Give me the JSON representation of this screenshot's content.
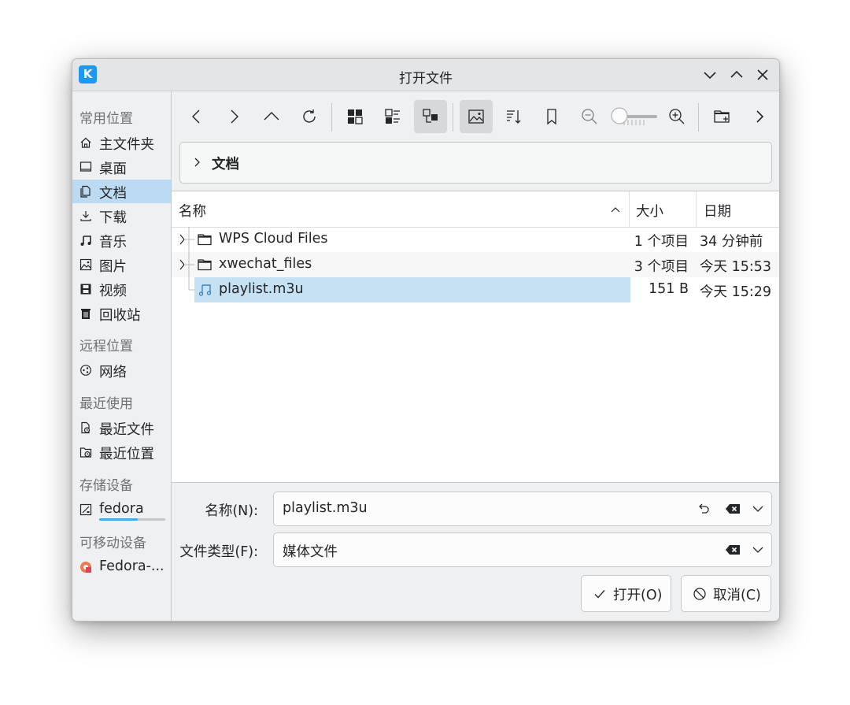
{
  "window": {
    "title": "打开文件",
    "app_icon": "kde-icon"
  },
  "sidebar": {
    "sections": [
      {
        "header": "常用位置",
        "items": [
          {
            "label": "主文件夹",
            "icon": "home-icon"
          },
          {
            "label": "桌面",
            "icon": "desktop-icon"
          },
          {
            "label": "文档",
            "icon": "documents-icon",
            "active": true
          },
          {
            "label": "下载",
            "icon": "download-icon"
          },
          {
            "label": "音乐",
            "icon": "music-icon"
          },
          {
            "label": "图片",
            "icon": "pictures-icon"
          },
          {
            "label": "视频",
            "icon": "videos-icon"
          },
          {
            "label": "回收站",
            "icon": "trash-icon"
          }
        ]
      },
      {
        "header": "远程位置",
        "items": [
          {
            "label": "网络",
            "icon": "network-icon"
          }
        ]
      },
      {
        "header": "最近使用",
        "items": [
          {
            "label": "最近文件",
            "icon": "recent-files-icon"
          },
          {
            "label": "最近位置",
            "icon": "recent-locations-icon"
          }
        ]
      },
      {
        "header": "存储设备",
        "items": [
          {
            "label": "fedora",
            "icon": "drive-icon",
            "usage_fraction": 0.58
          }
        ]
      },
      {
        "header": "可移动设备",
        "items": [
          {
            "label": "Fedora-...",
            "icon": "removable-media-icon"
          }
        ]
      }
    ]
  },
  "breadcrumb": {
    "current": "文档"
  },
  "columns": {
    "name": "名称",
    "size": "大小",
    "date": "日期"
  },
  "files": [
    {
      "name": "WPS Cloud Files",
      "size": "1 个项目",
      "date": "34 分钟前",
      "type": "folder"
    },
    {
      "name": "xwechat_files",
      "size": "3 个项目",
      "date": "今天 15:53",
      "type": "folder"
    },
    {
      "name": "playlist.m3u",
      "size": "151 B",
      "date": "今天 15:29",
      "type": "audio",
      "selected": true
    }
  ],
  "form": {
    "name_label": "名称(N):",
    "name_value": "playlist.m3u",
    "type_label": "文件类型(F):",
    "type_value": "媒体文件"
  },
  "buttons": {
    "open": "打开(O)",
    "cancel": "取消(C)"
  },
  "colors": {
    "selection": "#c5e1f3",
    "sidebar_active": "#bcdaf1",
    "accent": "#3daee9"
  }
}
